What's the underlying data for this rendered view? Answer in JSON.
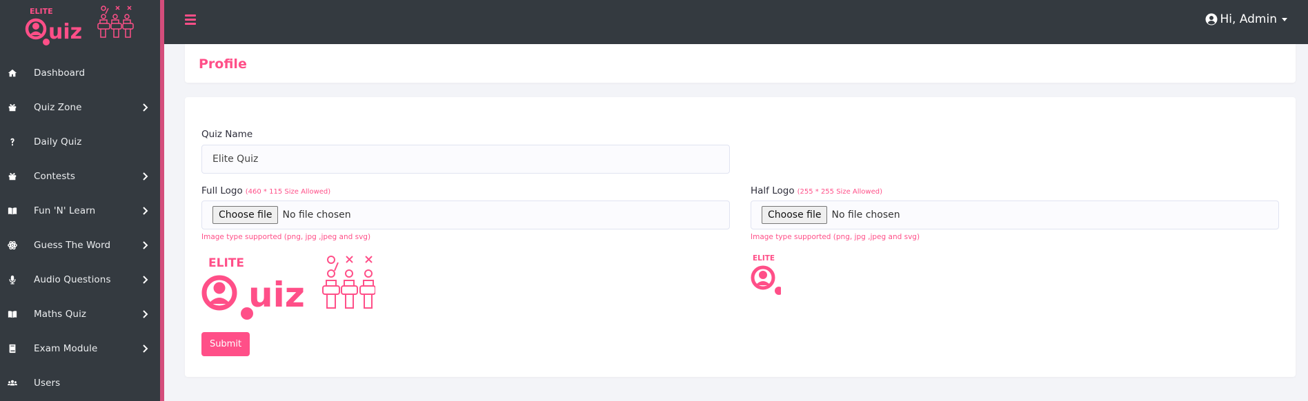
{
  "brand": {
    "small_text": "ELITE",
    "main_text": "Quiz"
  },
  "sidebar": {
    "items": [
      {
        "label": "Dashboard",
        "icon": "home-icon",
        "has_submenu": false
      },
      {
        "label": "Quiz Zone",
        "icon": "gift-icon",
        "has_submenu": true
      },
      {
        "label": "Daily Quiz",
        "icon": "question-icon",
        "has_submenu": false
      },
      {
        "label": "Contests",
        "icon": "gift-icon",
        "has_submenu": true
      },
      {
        "label": "Fun 'N' Learn",
        "icon": "book-open-icon",
        "has_submenu": true
      },
      {
        "label": "Guess The Word",
        "icon": "atom-icon",
        "has_submenu": true
      },
      {
        "label": "Audio Questions",
        "icon": "microphone-icon",
        "has_submenu": true
      },
      {
        "label": "Maths Quiz",
        "icon": "book-open-icon",
        "has_submenu": true
      },
      {
        "label": "Exam Module",
        "icon": "book-icon",
        "has_submenu": true
      },
      {
        "label": "Users",
        "icon": "users-icon",
        "has_submenu": false
      }
    ]
  },
  "topbar": {
    "user_label": "Hi, Admin"
  },
  "page": {
    "title": "Profile"
  },
  "form": {
    "quiz_name": {
      "label": "Quiz Name",
      "value": "Elite Quiz"
    },
    "full_logo": {
      "label": "Full Logo",
      "hint": "(460 * 115 Size Allowed)",
      "button": "Choose file",
      "status": "No file chosen",
      "support": "Image type supported (png, jpg ,jpeg and svg)"
    },
    "half_logo": {
      "label": "Half Logo",
      "hint": "(255 * 255 Size Allowed)",
      "button": "Choose file",
      "status": "No file chosen",
      "support": "Image type supported (png, jpg ,jpeg and svg)"
    },
    "submit_label": "Submit"
  },
  "colors": {
    "accent": "#ff4f88",
    "sidebar_bg": "#343a40",
    "stripe": "#d44d7b",
    "page_bg": "#f3f4f8"
  }
}
